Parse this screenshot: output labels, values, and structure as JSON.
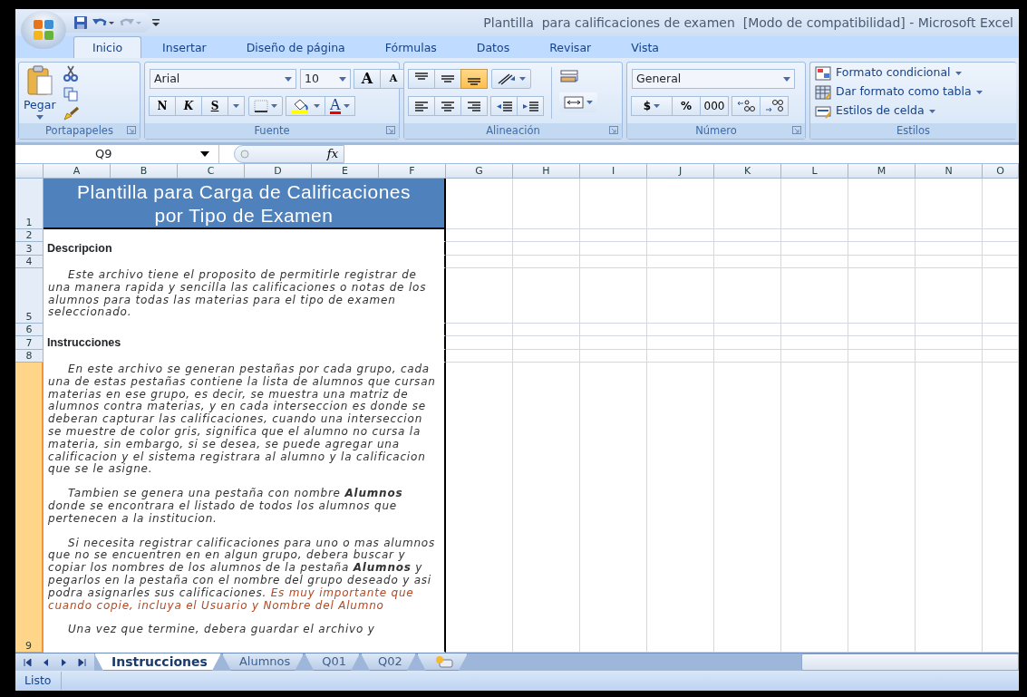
{
  "window": {
    "title": "Plantilla  para calificaciones de examen  [Modo de compatibilidad] - Microsoft Excel"
  },
  "ribbon_tabs": [
    {
      "label": "Inicio",
      "selected": true
    },
    {
      "label": "Insertar",
      "selected": false
    },
    {
      "label": "Diseño de página",
      "selected": false
    },
    {
      "label": "Fórmulas",
      "selected": false
    },
    {
      "label": "Datos",
      "selected": false
    },
    {
      "label": "Revisar",
      "selected": false
    },
    {
      "label": "Vista",
      "selected": false
    }
  ],
  "ribbon": {
    "clipboard": {
      "paste": "Pegar",
      "label": "Portapapeles"
    },
    "font": {
      "name": "Arial",
      "size": "10",
      "grow": "A",
      "shrink": "A",
      "bold": "N",
      "italic": "K",
      "underline": "S",
      "font_color": "A",
      "label": "Fuente"
    },
    "alignment": {
      "vertical": [
        {
          "selected": false
        },
        {
          "selected": false
        },
        {
          "selected": true
        }
      ],
      "label": "Alineación"
    },
    "number": {
      "format": "General",
      "currency": "$",
      "percent": "%",
      "thousands": "000",
      "label": "Número"
    },
    "styles": {
      "items": [
        "Formato condicional",
        "Dar formato como tabla",
        "Estilos de celda"
      ],
      "label": "Estilos"
    }
  },
  "formula_bar": {
    "name_box": "Q9",
    "fx": "fx"
  },
  "columns": [
    "A",
    "B",
    "C",
    "D",
    "E",
    "F",
    "G",
    "H",
    "I",
    "J",
    "K",
    "L",
    "M",
    "N",
    "O"
  ],
  "rows": [
    {
      "number": "1",
      "selected": false,
      "kind": "title",
      "text": "Plantilla para Carga de Calificaciones por Tipo de Examen"
    },
    {
      "number": "2",
      "selected": false,
      "kind": "blank"
    },
    {
      "number": "3",
      "selected": false,
      "kind": "heading",
      "text": "Descripcion"
    },
    {
      "number": "4",
      "selected": false,
      "kind": "blank"
    },
    {
      "number": "5",
      "selected": false,
      "kind": "paragraphs",
      "paragraphs": [
        {
          "runs": [
            {
              "kind": "normal",
              "text": "Este archivo tiene el proposito de permitirle registrar de una manera rapida y sencilla las calificaciones o notas de los alumnos para todas las materias para el tipo de examen seleccionado."
            }
          ]
        }
      ]
    },
    {
      "number": "6",
      "selected": false,
      "kind": "blank"
    },
    {
      "number": "7",
      "selected": false,
      "kind": "heading",
      "text": "Instrucciones"
    },
    {
      "number": "8",
      "selected": false,
      "kind": "blank"
    },
    {
      "number": "9",
      "selected": true,
      "kind": "paragraphs",
      "paragraphs": [
        {
          "runs": [
            {
              "kind": "normal",
              "text": "En este archivo se generan pestañas por cada grupo, cada una de estas pestañas contiene la lista de alumnos que cursan materias en ese grupo, es decir, se muestra una matriz de alumnos contra materias, y en cada interseccion es donde se deberan capturar las calificaciones, cuando una interseccion se muestre de color gris, significa que el alumno no cursa la materia, sin embargo, si se desea, se puede agregar una calificacion y el sistema registrara al alumno y la calificacion que se le asigne."
            }
          ]
        },
        {
          "runs": [
            {
              "kind": "normal",
              "text": "Tambien se genera una pestaña con nombre  **Alumnos** donde se encontrara el listado de todos los alumnos que pertenecen a la institucion."
            }
          ]
        },
        {
          "runs": [
            {
              "kind": "normal",
              "text": "Si necesita registrar calificaciones para uno o mas alumnos que no se encuentren en en algun grupo, debera buscar y copiar los nombres de los alumnos de la pestaña **Alumnos** y pegarlos en la pestaña con el nombre del grupo deseado y asi podra asignarles sus calificaciones.  "
            },
            {
              "kind": "warning",
              "text": "Es muy importante que cuando copie, incluya el Usuario y Nombre del Alumno"
            }
          ]
        },
        {
          "runs": [
            {
              "kind": "normal",
              "text": "Una vez que termine, debera guardar el archivo y"
            }
          ]
        }
      ]
    }
  ],
  "sheet_tabs": [
    {
      "label": "Instrucciones",
      "selected": true
    },
    {
      "label": "Alumnos",
      "selected": false
    },
    {
      "label": "Q01",
      "selected": false
    },
    {
      "label": "Q02",
      "selected": false
    }
  ],
  "status_bar": {
    "text": "Listo"
  }
}
